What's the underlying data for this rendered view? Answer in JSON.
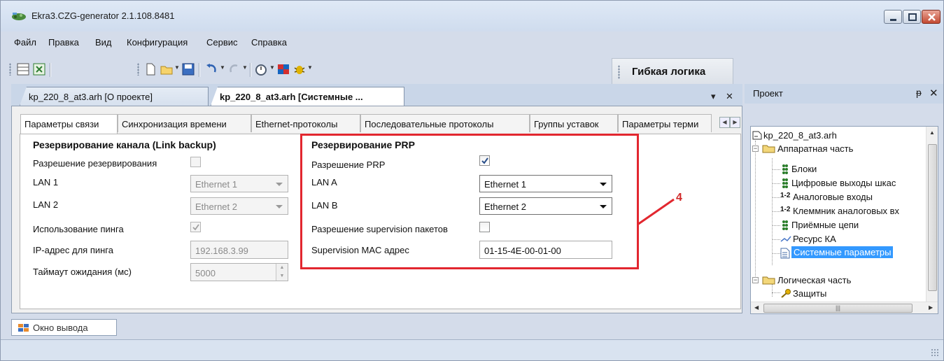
{
  "window": {
    "title": "Ekra3.CZG-generator 2.1.108.8481",
    "accent_color": "#c34a33"
  },
  "menu": {
    "items": [
      {
        "label": "Файл"
      },
      {
        "label": "Правка"
      },
      {
        "label": "Вид"
      },
      {
        "label": "Конфигурация"
      },
      {
        "label": "Сервис"
      },
      {
        "label": "Справка"
      }
    ]
  },
  "toolbar": {
    "flex_logic_label": "Гибкая логика"
  },
  "doc_tabs": [
    {
      "label": "kp_220_8_at3.arh [О проекте]",
      "active": false
    },
    {
      "label": "kp_220_8_at3.arh [Системные ...",
      "active": true
    }
  ],
  "doc_controls": {
    "dropdown_glyph": "▾",
    "close_glyph": "✕"
  },
  "sub_tabs": [
    {
      "label": "Параметры связи"
    },
    {
      "label": "Синхронизация времени"
    },
    {
      "label": "Ethernet-протоколы"
    },
    {
      "label": "Последовательные протоколы"
    },
    {
      "label": "Группы уставок"
    },
    {
      "label": "Параметры терми"
    }
  ],
  "link_backup": {
    "title": "Резервирование канала (Link backup)",
    "enable_label": "Разрешение резервирования",
    "enable_checked": false,
    "lan1_label": "LAN 1",
    "lan1_value": "Ethernet 1",
    "lan2_label": "LAN 2",
    "lan2_value": "Ethernet 2",
    "ping_label": "Использование пинга",
    "ping_checked": true,
    "ping_ip_label": "IP-адрес для пинга",
    "ping_ip_value": "192.168.3.99",
    "timeout_label": "Таймаут ожидания (мс)",
    "timeout_value": "5000"
  },
  "prp": {
    "title": "Резервирование PRP",
    "enable_label": "Разрешение PRP",
    "enable_checked": true,
    "lana_label": "LAN A",
    "lana_value": "Ethernet 1",
    "lanb_label": "LAN B",
    "lanb_value": "Ethernet 2",
    "supervision_label": "Разрешение supervision пакетов",
    "supervision_checked": false,
    "mac_label": "Supervision MAC адрес",
    "mac_value": "01-15-4E-00-01-00",
    "highlight_color": "#e2272f"
  },
  "callout": {
    "number": "4"
  },
  "output": {
    "tab_label": "Окно вывода"
  },
  "project": {
    "title": "Проект",
    "pin_glyph": "ᵽ",
    "close_glyph": "✕",
    "tree": [
      {
        "label": "kp_220_8_at3.arh",
        "icon": "project-file-icon"
      },
      {
        "label": "Аппаратная часть",
        "icon": "folder-open-icon"
      },
      {
        "label": "Блоки",
        "icon": "blocks-icon"
      },
      {
        "label": "Цифровые выходы шкас",
        "icon": "digital-outputs-icon"
      },
      {
        "label": "Аналоговые входы",
        "icon": "analog-inputs-icon",
        "prefix": "1-2"
      },
      {
        "label": "Клеммник аналоговых вх",
        "icon": "terminal-icon",
        "prefix": "1-2"
      },
      {
        "label": "Приёмные цепи",
        "icon": "receive-circuits-icon"
      },
      {
        "label": "Ресурс КА",
        "icon": "resource-icon"
      },
      {
        "label": "Системные параметры",
        "icon": "system-params-icon",
        "selected": true
      },
      {
        "label": "Логическая часть",
        "icon": "folder-icon"
      },
      {
        "label": "Защиты",
        "icon": "key-icon"
      }
    ]
  }
}
